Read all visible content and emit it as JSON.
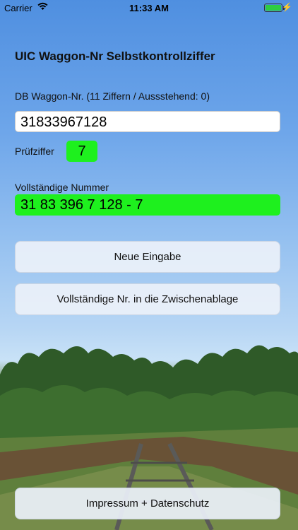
{
  "status_bar": {
    "carrier": "Carrier",
    "time": "11:33 AM"
  },
  "title": "UIC Waggon-Nr Selbstkontrollziffer",
  "waggon_input": {
    "label": "DB Waggon-Nr. (11 Ziffern / Aussstehend: 0)",
    "value": "31833967128"
  },
  "check_digit": {
    "label": "Prüfziffer",
    "value": "7"
  },
  "full_number": {
    "label": "Vollständige Nummer",
    "value": "31 83 396 7 128 - 7"
  },
  "buttons": {
    "new_entry": "Neue Eingabe",
    "copy_clipboard": "Vollständige Nr. in die Zwischenablage",
    "imprint": "Impressum + Datenschutz"
  },
  "colors": {
    "accent_green": "#1ef01e"
  }
}
